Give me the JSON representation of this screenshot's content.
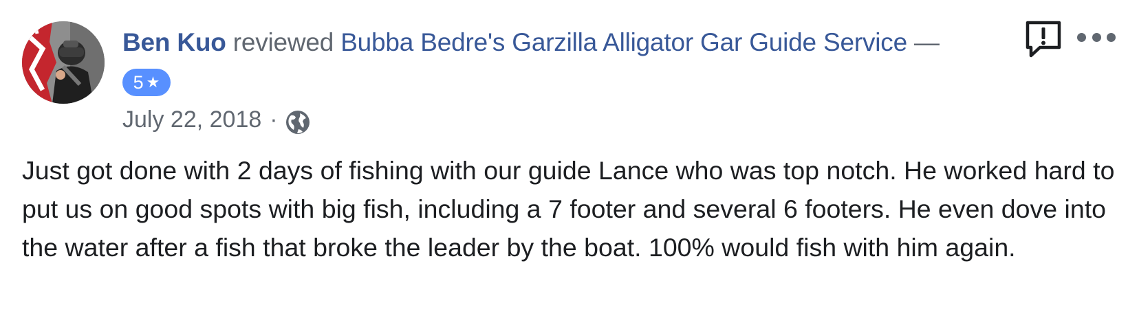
{
  "review": {
    "author": "Ben Kuo",
    "verb": "reviewed",
    "page": "Bubba Bedre's Garzilla Alligator Gar Guide Service",
    "dash": "—",
    "rating": "5",
    "rating_icon": "star-icon",
    "date": "July 22, 2018",
    "separator": "·",
    "audience_icon": "globe-icon",
    "text": "Just got done with 2 days of fishing with our guide Lance who was top notch. He worked hard to put us on good spots with big fish, including a 7 footer and several 6 footers. He even dove into the water after a fish that broke the leader by the boat. 100% would fish with him again."
  },
  "actions": {
    "report_icon": "report-icon",
    "more_icon": "more-options-icon"
  },
  "colors": {
    "link": "#385898",
    "secondary_text": "#606770",
    "body_text": "#1c1e21",
    "rating_badge": "#5890ff"
  }
}
